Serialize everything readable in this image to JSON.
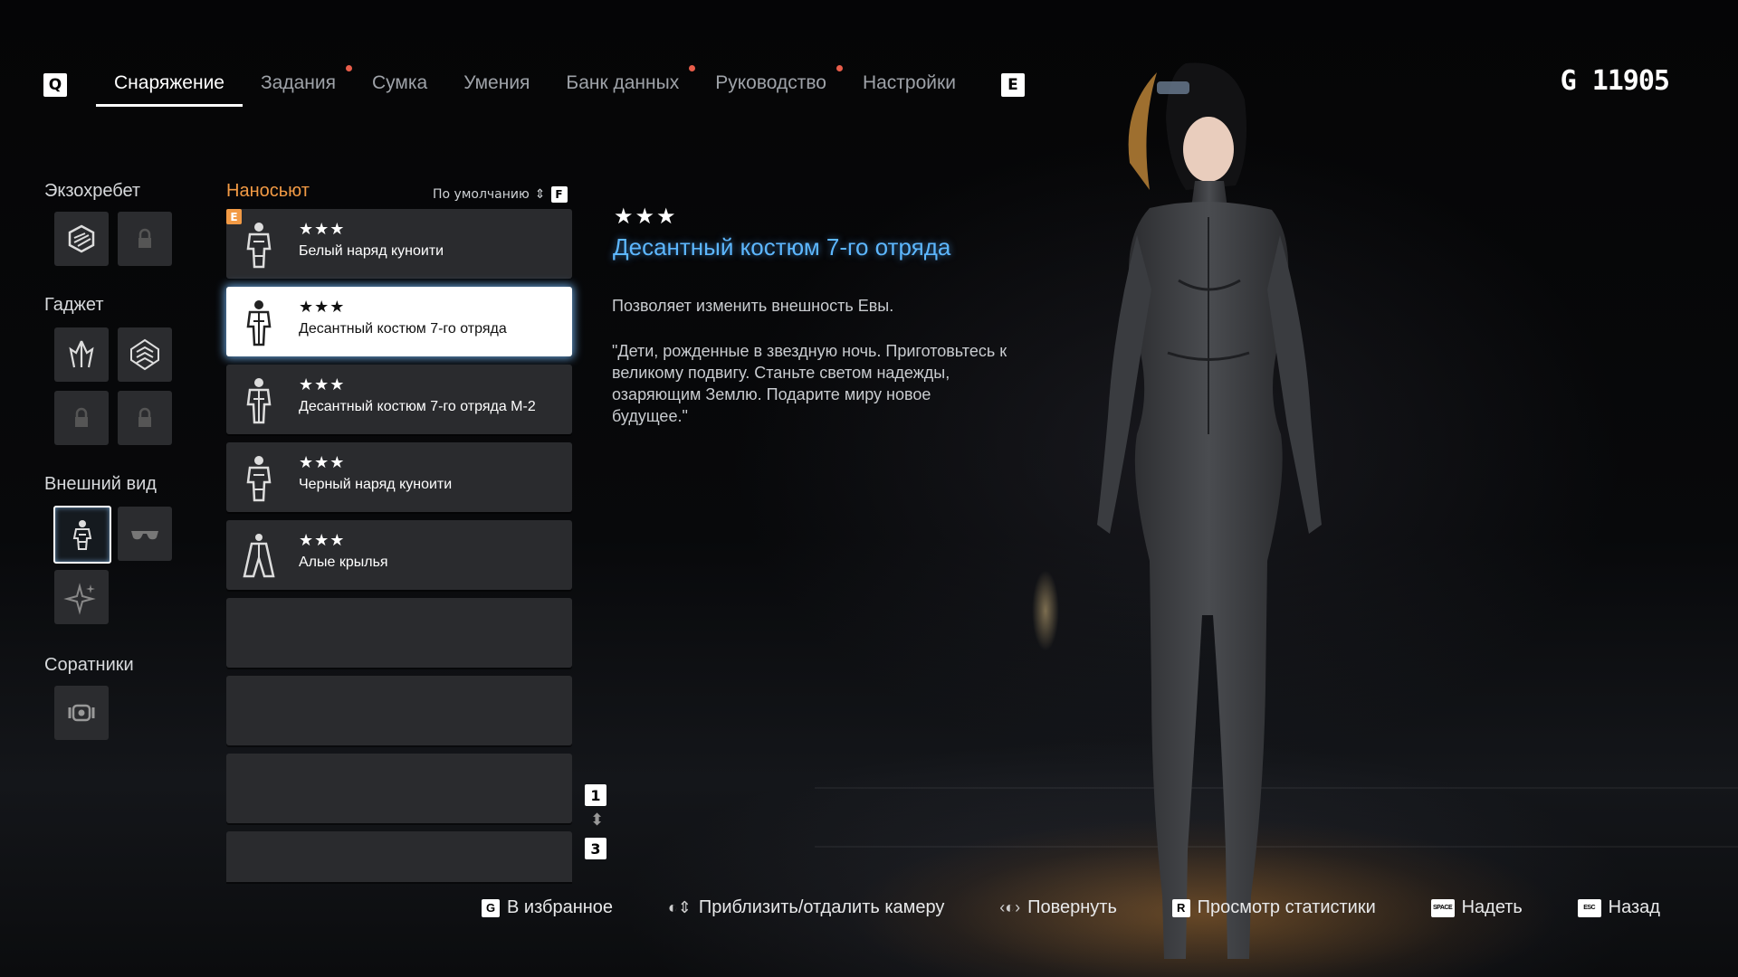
{
  "nav": {
    "left_key": "Q",
    "right_key": "E",
    "tabs": [
      {
        "label": "Снаряжение",
        "active": true,
        "notify": false
      },
      {
        "label": "Задания",
        "active": false,
        "notify": true
      },
      {
        "label": "Сумка",
        "active": false,
        "notify": false
      },
      {
        "label": "Умения",
        "active": false,
        "notify": false
      },
      {
        "label": "Банк данных",
        "active": false,
        "notify": true
      },
      {
        "label": "Руководство",
        "active": false,
        "notify": true
      },
      {
        "label": "Настройки",
        "active": false,
        "notify": false
      }
    ]
  },
  "currency": {
    "symbol": "G",
    "amount": "11905"
  },
  "categories": {
    "exospine": "Экзохребет",
    "gadget": "Гаджет",
    "appearance": "Внешний вид",
    "companions": "Соратники"
  },
  "list": {
    "title": "Наносьют",
    "sort_label": "По умолчанию",
    "sort_key": "F",
    "equipped_badge": "E",
    "items": [
      {
        "stars": "★★★",
        "name": "Белый наряд куноити"
      },
      {
        "stars": "★★★",
        "name": "Десантный костюм 7-го отряда"
      },
      {
        "stars": "★★★",
        "name": "Десантный костюм 7-го отряда М-2"
      },
      {
        "stars": "★★★",
        "name": "Черный наряд куноити"
      },
      {
        "stars": "★★★",
        "name": "Алые крылья"
      }
    ],
    "page_up": "1",
    "page_down": "3"
  },
  "details": {
    "stars": "★★★",
    "title": "Десантный костюм 7-го отряда",
    "description": "Позволяет изменить внешность Евы.",
    "quote": "\"Дети, рожденные в звездную ночь. Приготовьтесь к великому подвигу. Станьте светом надежды, озаряющим Землю. Подарите миру новое будущее.\""
  },
  "hints": {
    "favorite_key": "G",
    "favorite": "В избранное",
    "zoom": "Приблизить/отдалить камеру",
    "rotate": "Повернуть",
    "stats_key": "R",
    "stats": "Просмотр статистики",
    "equip_key": "SPACE",
    "equip": "Надеть",
    "back_key": "ESC",
    "back": "Назад"
  },
  "colors": {
    "accent_orange": "#f29a45",
    "title_blue": "#5db7ff",
    "notify_red": "#e85d4a"
  }
}
